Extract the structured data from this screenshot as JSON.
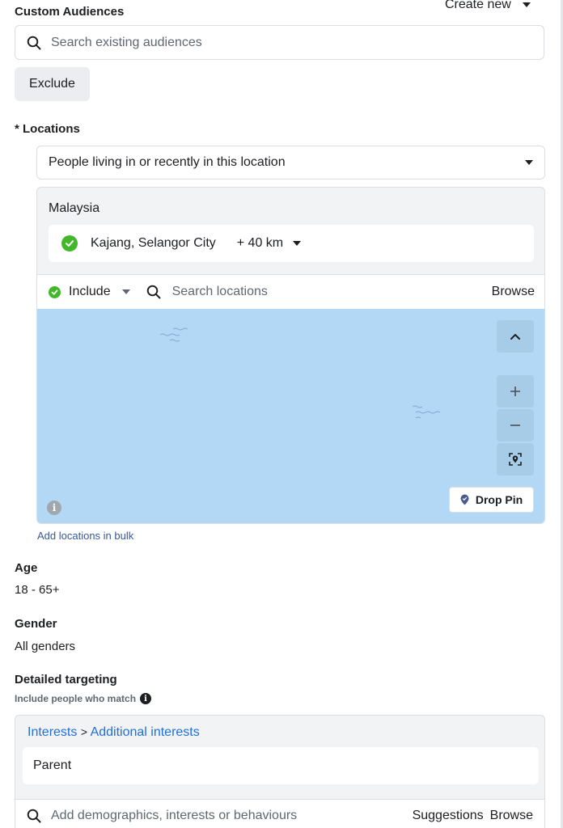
{
  "custom_audiences": {
    "title": "Custom Audiences",
    "create_new_label": "Create new",
    "search_placeholder": "Search existing audiences",
    "exclude_label": "Exclude"
  },
  "locations": {
    "title": "* Locations",
    "type_select_value": "People living in or recently in this location",
    "country": "Malaysia",
    "selected_location": "Kajang, Selangor City",
    "radius": "+ 40 km",
    "include_label": "Include",
    "search_placeholder": "Search locations",
    "browse_label": "Browse",
    "drop_pin_label": "Drop Pin",
    "add_bulk_label": "Add locations in bulk"
  },
  "age": {
    "title": "Age",
    "value": "18 - 65+"
  },
  "gender": {
    "title": "Gender",
    "value": "All genders"
  },
  "detailed_targeting": {
    "title": "Detailed targeting",
    "subtitle": "Include people who match",
    "breadcrumb_interests": "Interests",
    "breadcrumb_sep": ">",
    "breadcrumb_additional": "Additional interests",
    "parent_item": "Parent",
    "search_placeholder": "Add demographics, interests or behaviours",
    "suggestions_label": "Suggestions",
    "browse_label": "Browse"
  },
  "colors": {
    "map_water": "#b3d8f5",
    "check_green": "#42b72a",
    "link_blue": "#216fdb",
    "small_link_blue": "#385898"
  },
  "icons": {
    "search": "search-icon",
    "caret": "caret-down-icon",
    "check": "check-shield-icon",
    "chevron_up": "chevron-up-icon",
    "plus": "plus-icon",
    "minus": "minus-icon",
    "locate": "locate-icon",
    "pin": "pin-icon",
    "info": "info-icon"
  }
}
